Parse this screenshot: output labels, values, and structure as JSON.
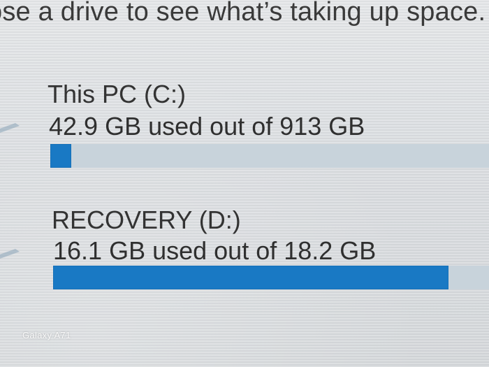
{
  "instruction": "ose a drive to see what’s taking up space.",
  "drives": [
    {
      "name": "This PC (C:)",
      "usage_text": "42.9 GB used out of 913 GB",
      "used_fraction": 0.047,
      "icon": "drive-icon"
    },
    {
      "name": "RECOVERY (D:)",
      "usage_text": "16.1 GB used out of 18.2 GB",
      "used_fraction": 0.885,
      "icon": "drive-icon"
    }
  ],
  "colors": {
    "bar_fill": "#1979c4",
    "bar_track": "#c8d3db"
  },
  "watermark": "Galaxy A71"
}
